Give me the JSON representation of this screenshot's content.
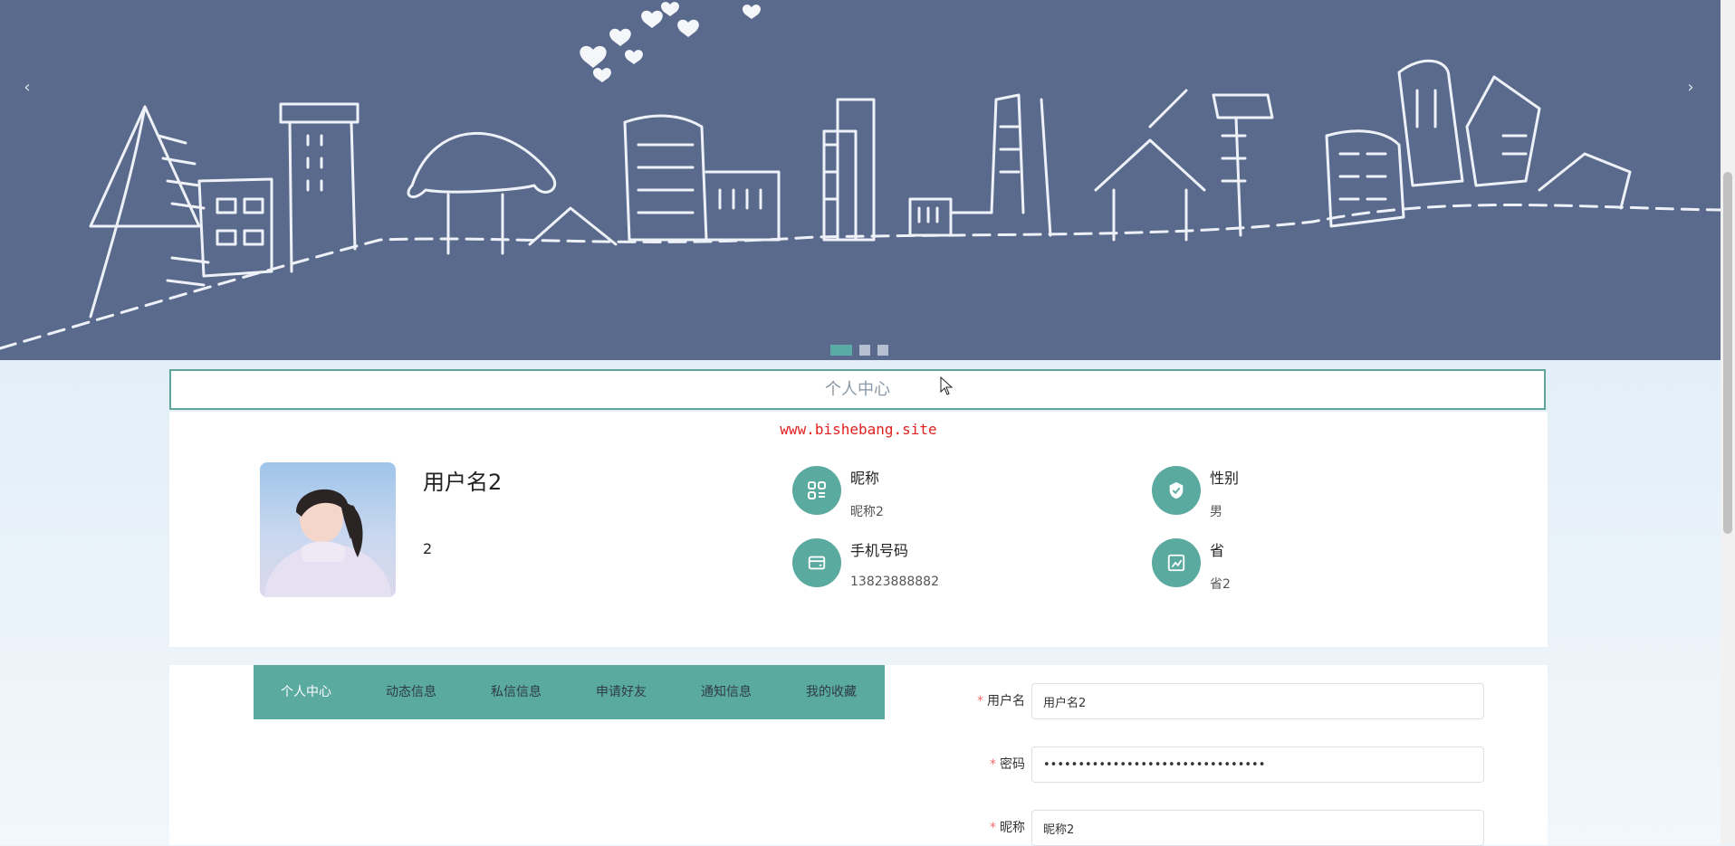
{
  "carousel": {
    "prev_icon": "‹",
    "next_icon": "›",
    "slide_count": 3,
    "active_slide": 1,
    "background_color": "#5a6a8c",
    "active_dot_color": "#5aaaa7"
  },
  "page": {
    "title": "个人中心",
    "watermark": "www.bishebang.site"
  },
  "profile": {
    "username": "用户名2",
    "sub_text": "2",
    "fields": [
      {
        "label": "昵称",
        "value": "昵称2",
        "icon": "grid-icon"
      },
      {
        "label": "性别",
        "value": "男",
        "icon": "shield-icon"
      },
      {
        "label": "手机号码",
        "value": "13823888882",
        "icon": "wallet-icon"
      },
      {
        "label": "省",
        "value": "省2",
        "icon": "chart-icon"
      }
    ]
  },
  "tabs": [
    "个人中心",
    "动态信息",
    "私信信息",
    "申请好友",
    "通知信息",
    "我的收藏"
  ],
  "active_tab": 0,
  "form": {
    "required_mark": "*",
    "username_label": "用户名",
    "username_value": "用户名2",
    "password_label": "密码",
    "password_value": "••••••••••••••••••••••••••••••••",
    "nickname_label": "昵称",
    "nickname_value": "昵称2"
  },
  "accent_color": "#5aaaa0"
}
